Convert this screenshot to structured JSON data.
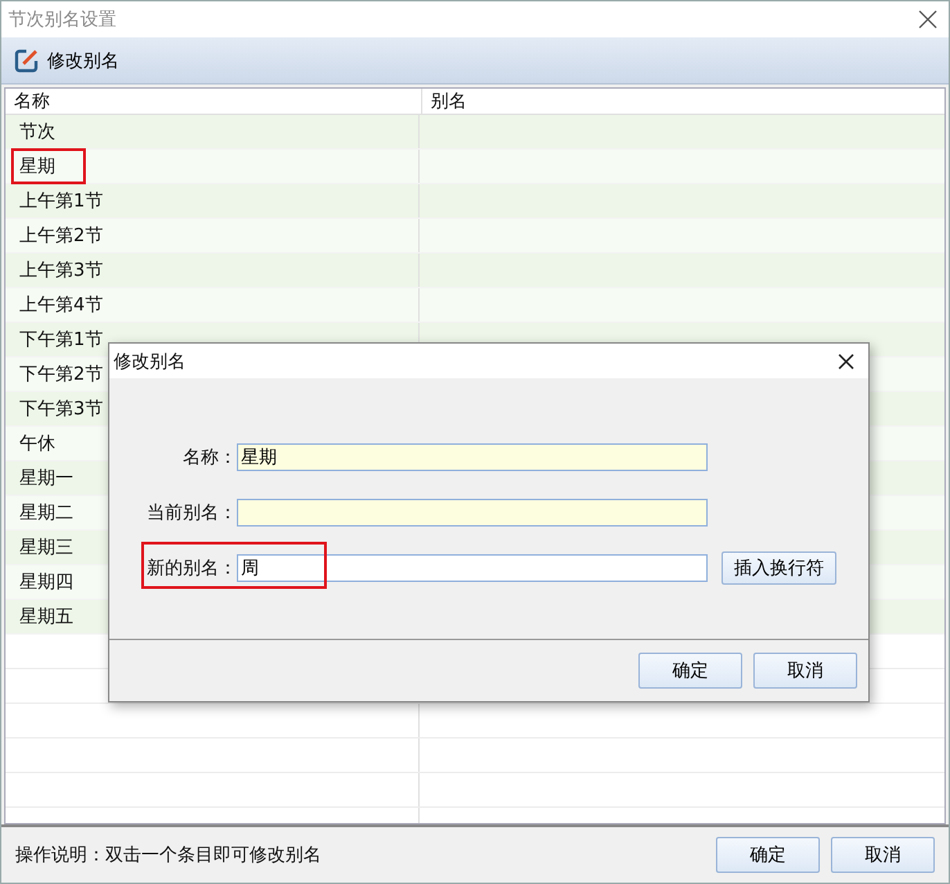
{
  "window": {
    "title": "节次别名设置"
  },
  "toolbar": {
    "button": "修改别名"
  },
  "table": {
    "columns": [
      "名称",
      "别名"
    ],
    "rows": [
      {
        "name": "节次",
        "highlighted": false
      },
      {
        "name": "星期",
        "highlighted": true
      },
      {
        "name": "上午第1节",
        "highlighted": false
      },
      {
        "name": "上午第2节",
        "highlighted": false
      },
      {
        "name": "上午第3节",
        "highlighted": false
      },
      {
        "name": "上午第4节",
        "highlighted": false
      },
      {
        "name": "下午第1节",
        "highlighted": false
      },
      {
        "name": "下午第2节",
        "highlighted": false
      },
      {
        "name": "下午第3节",
        "highlighted": false
      },
      {
        "name": "午休",
        "highlighted": false
      },
      {
        "name": "星期一",
        "highlighted": false
      },
      {
        "name": "星期二",
        "highlighted": false
      },
      {
        "name": "星期三",
        "highlighted": false
      },
      {
        "name": "星期四",
        "highlighted": false
      },
      {
        "name": "星期五",
        "highlighted": false
      }
    ]
  },
  "footer": {
    "hint": "操作说明：双击一个条目即可修改别名",
    "buttons": [
      "确定",
      "取消"
    ]
  },
  "dialog": {
    "title": "修改别名",
    "fields": [
      {
        "label": "名称：",
        "value": "星期",
        "readonly": true,
        "highlighted": false
      },
      {
        "label": "当前别名：",
        "readonly": true,
        "highlighted": false
      },
      {
        "label": "新的别名：",
        "value": "周",
        "readonly": false,
        "highlighted": true,
        "button": "插入换行符"
      }
    ],
    "buttons": [
      "确定",
      "取消"
    ]
  }
}
